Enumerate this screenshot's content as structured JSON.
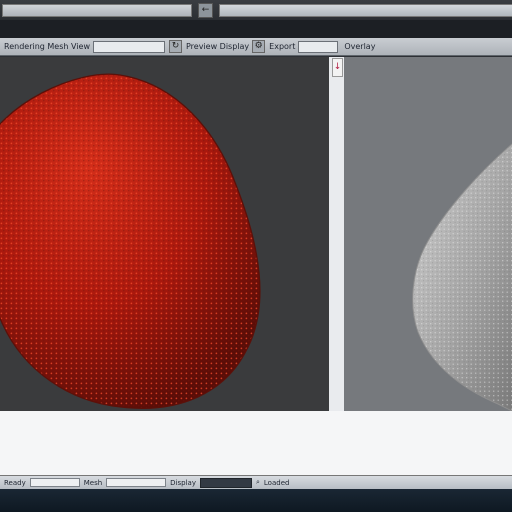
{
  "toolbar": {
    "items": [
      "Rendering Mesh View",
      "Preview Display",
      "Export",
      "Overlay"
    ]
  },
  "status": {
    "items": [
      "Ready",
      "Mesh",
      "Display",
      "Loaded"
    ]
  },
  "icons": {
    "back": "←",
    "refresh": "↻",
    "marker": "↓",
    "settings": "⚙",
    "filter": "⌕"
  },
  "colors": {
    "accent": "#b21e43",
    "mesh_red": "#b31b12",
    "mesh_gray": "#b9b9b9"
  }
}
